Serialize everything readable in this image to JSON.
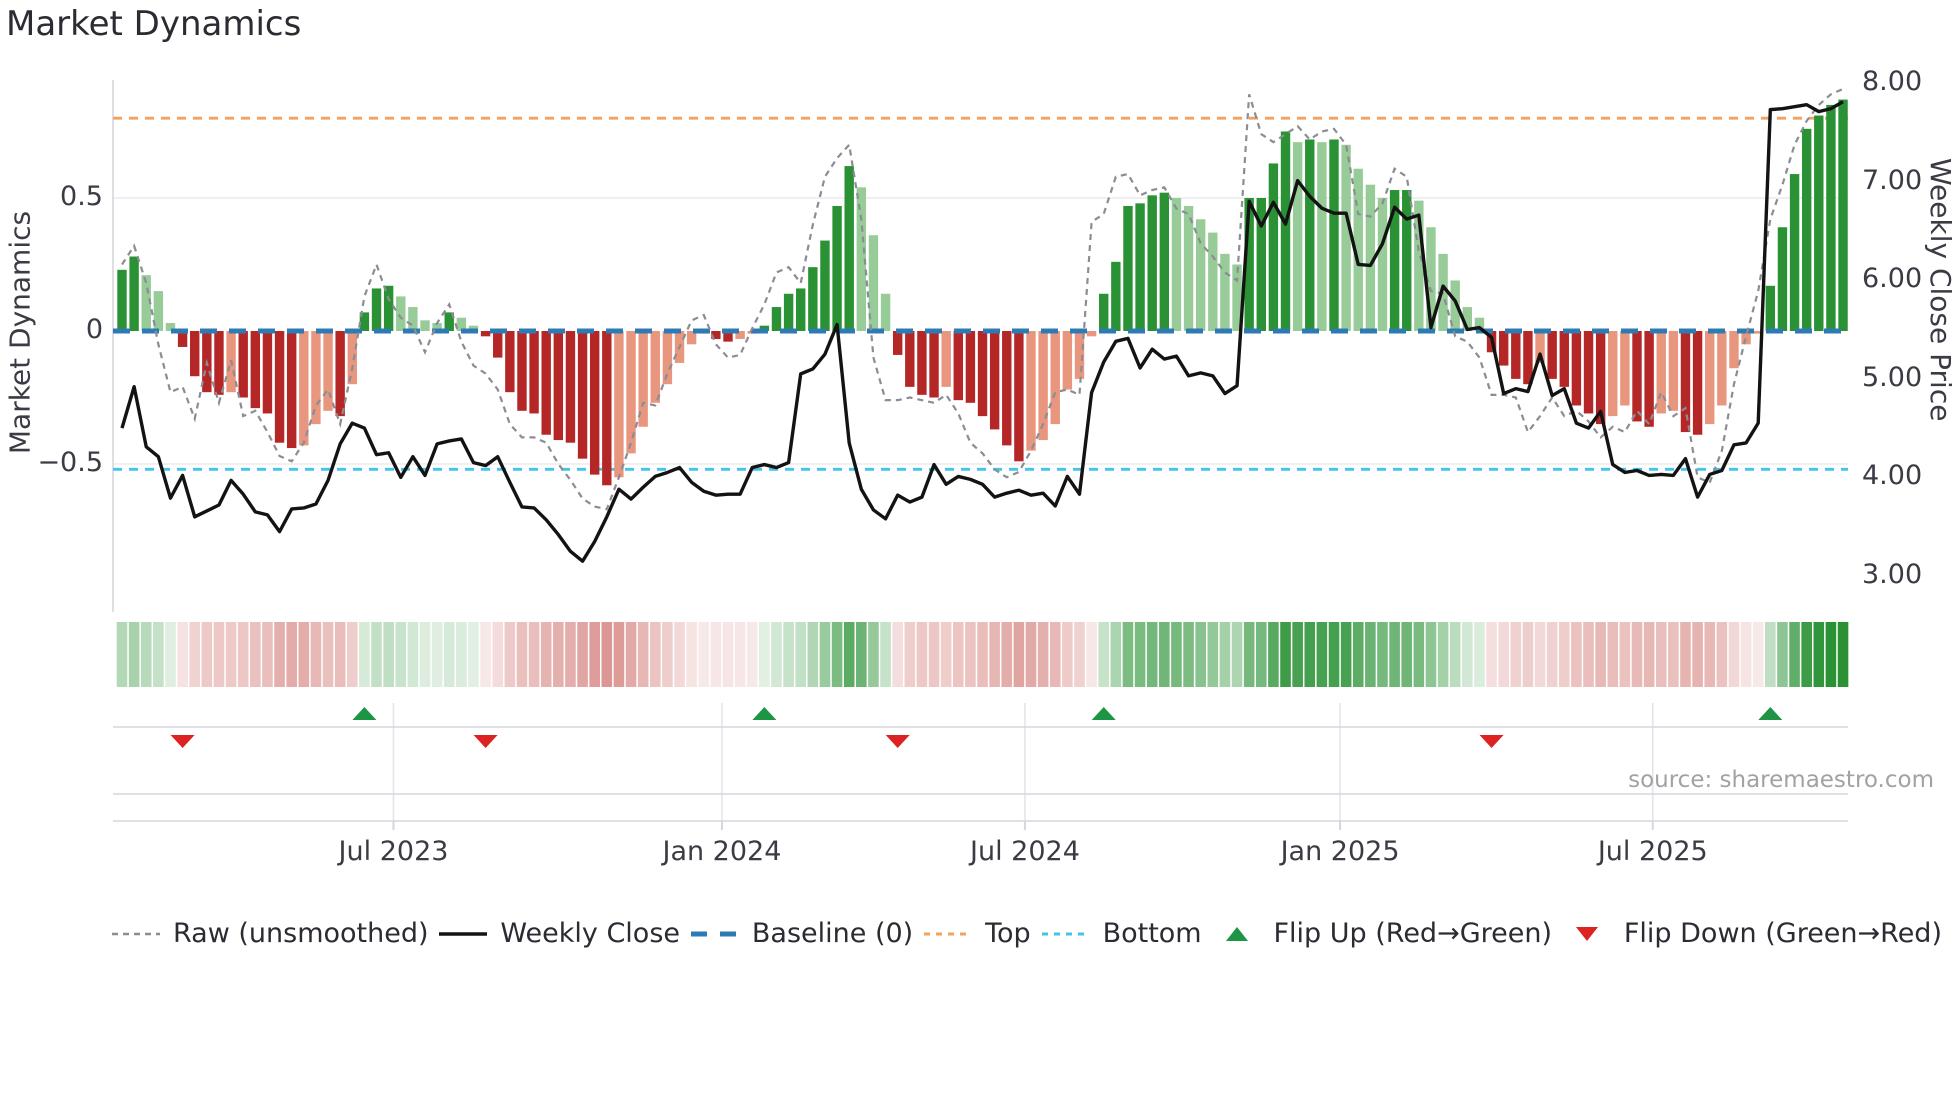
{
  "title": "Market Dynamics",
  "source": "source: sharemaestro.com",
  "axes": {
    "left_label": "Market Dynamics",
    "right_label": "Weekly Close Price",
    "left_ticks": [
      {
        "label": "0.5",
        "value": 0.5
      },
      {
        "label": "0",
        "value": 0.0
      },
      {
        "label": "−0.5",
        "value": -0.5
      }
    ],
    "right_ticks": [
      {
        "label": "8.00",
        "value": 8.0
      },
      {
        "label": "7.00",
        "value": 7.0
      },
      {
        "label": "6.00",
        "value": 6.0
      },
      {
        "label": "5.00",
        "value": 5.0
      },
      {
        "label": "4.00",
        "value": 4.0
      },
      {
        "label": "3.00",
        "value": 3.0
      }
    ],
    "x_ticks": [
      {
        "label": "Jul 2023",
        "week": 22.4
      },
      {
        "label": "Jan 2024",
        "week": 49.5
      },
      {
        "label": "Jul 2024",
        "week": 74.5
      },
      {
        "label": "Jan 2025",
        "week": 100.5
      },
      {
        "label": "Jul 2025",
        "week": 126.3
      }
    ]
  },
  "legend": [
    {
      "label": "Raw (unsmoothed)",
      "swatch": "dashed-gray-line"
    },
    {
      "label": "Weekly Close",
      "swatch": "solid-black-line"
    },
    {
      "label": "Baseline (0)",
      "swatch": "dashed-blue-line"
    },
    {
      "label": "Top",
      "swatch": "dotted-orange-line"
    },
    {
      "label": "Bottom",
      "swatch": "dotted-cyan-line"
    },
    {
      "label": "Flip Up (Red→Green)",
      "swatch": "triangle-up-green"
    },
    {
      "label": "Flip Down (Green→Red)",
      "swatch": "triangle-down-red"
    }
  ],
  "colors": {
    "bar_dark_green": "#2a9235",
    "bar_light_green": "#97cb98",
    "bar_dark_red": "#b52727",
    "bar_light_red": "#e9967f",
    "baseline_blue": "#2e7bb4",
    "top_orange": "#f0a25f",
    "bottom_cyan": "#3fc6ea",
    "raw_gray": "#8c8c94",
    "close_black": "#131313",
    "grid_gray": "#ebebf0",
    "spine_gray": "#d6d6de",
    "heat_green_base": [
      42,
      146,
      53
    ],
    "heat_red_base": [
      198,
      86,
      80
    ]
  },
  "chart_data": {
    "type": "bar",
    "title": "Market Dynamics",
    "x_unit": "week",
    "start_date": "2023-01-30",
    "weeks": 143,
    "left_axis": {
      "label": "Market Dynamics",
      "ylim": [
        -1.06,
        0.94
      ],
      "gridlines": [
        0.5,
        -0.5
      ]
    },
    "right_axis": {
      "label": "Weekly Close Price",
      "ylim": [
        2.63,
        8.03
      ]
    },
    "reference_lines": {
      "baseline": 0.0,
      "top": 0.8,
      "bottom": -0.52
    },
    "flip_up_weeks": [
      20,
      53,
      81,
      136
    ],
    "flip_down_weeks": [
      5,
      30,
      64,
      113
    ],
    "series": [
      {
        "name": "Oscillator histogram (smoothed)",
        "axis": "left",
        "type": "bar",
        "values": [
          0.23,
          0.28,
          0.21,
          0.15,
          0.03,
          -0.06,
          -0.17,
          -0.23,
          -0.24,
          -0.23,
          -0.25,
          -0.29,
          -0.31,
          -0.42,
          -0.44,
          -0.43,
          -0.35,
          -0.3,
          -0.32,
          -0.2,
          0.07,
          0.16,
          0.17,
          0.13,
          0.09,
          0.04,
          0.03,
          0.07,
          0.05,
          0.02,
          -0.02,
          -0.1,
          -0.23,
          -0.3,
          -0.31,
          -0.39,
          -0.41,
          -0.42,
          -0.48,
          -0.54,
          -0.58,
          -0.55,
          -0.46,
          -0.36,
          -0.27,
          -0.2,
          -0.12,
          -0.05,
          -0.01,
          -0.03,
          -0.04,
          -0.03,
          -0.01,
          0.02,
          0.09,
          0.14,
          0.16,
          0.24,
          0.34,
          0.47,
          0.62,
          0.54,
          0.36,
          0.14,
          -0.09,
          -0.21,
          -0.24,
          -0.25,
          -0.21,
          -0.26,
          -0.27,
          -0.32,
          -0.37,
          -0.43,
          -0.49,
          -0.45,
          -0.41,
          -0.35,
          -0.22,
          -0.18,
          -0.02,
          0.14,
          0.26,
          0.47,
          0.48,
          0.51,
          0.52,
          0.5,
          0.47,
          0.42,
          0.37,
          0.29,
          0.25,
          0.5,
          0.5,
          0.63,
          0.75,
          0.71,
          0.72,
          0.71,
          0.72,
          0.7,
          0.61,
          0.55,
          0.5,
          0.53,
          0.53,
          0.49,
          0.39,
          0.29,
          0.19,
          0.09,
          0.05,
          -0.08,
          -0.13,
          -0.18,
          -0.2,
          -0.12,
          -0.18,
          -0.21,
          -0.28,
          -0.31,
          -0.35,
          -0.32,
          -0.28,
          -0.34,
          -0.36,
          -0.31,
          -0.3,
          -0.38,
          -0.39,
          -0.35,
          -0.28,
          -0.14,
          -0.05,
          -0.01,
          0.17,
          0.39,
          0.59,
          0.76,
          0.81,
          0.85,
          0.87
        ]
      },
      {
        "name": "Raw (unsmoothed)",
        "axis": "left",
        "type": "line",
        "style": "dashed",
        "values": [
          0.25,
          0.32,
          0.18,
          -0.05,
          -0.23,
          -0.21,
          -0.33,
          -0.12,
          -0.27,
          -0.11,
          -0.32,
          -0.3,
          -0.38,
          -0.47,
          -0.49,
          -0.42,
          -0.28,
          -0.22,
          -0.35,
          -0.14,
          0.13,
          0.25,
          0.12,
          0.05,
          0.02,
          -0.08,
          0.03,
          0.1,
          -0.04,
          -0.13,
          -0.16,
          -0.22,
          -0.35,
          -0.4,
          -0.4,
          -0.42,
          -0.5,
          -0.56,
          -0.63,
          -0.66,
          -0.67,
          -0.55,
          -0.42,
          -0.27,
          -0.28,
          -0.16,
          -0.06,
          0.04,
          0.06,
          -0.05,
          -0.1,
          -0.09,
          0.01,
          0.1,
          0.22,
          0.24,
          0.18,
          0.4,
          0.58,
          0.65,
          0.7,
          0.42,
          -0.1,
          -0.26,
          -0.26,
          -0.25,
          -0.26,
          -0.27,
          -0.24,
          -0.31,
          -0.42,
          -0.46,
          -0.52,
          -0.55,
          -0.53,
          -0.45,
          -0.35,
          -0.23,
          -0.22,
          -0.24,
          0.41,
          0.44,
          0.58,
          0.59,
          0.51,
          0.53,
          0.54,
          0.46,
          0.44,
          0.33,
          0.28,
          0.22,
          0.19,
          0.89,
          0.74,
          0.71,
          0.74,
          0.77,
          0.72,
          0.75,
          0.76,
          0.7,
          0.44,
          0.43,
          0.48,
          0.61,
          0.58,
          0.3,
          0.15,
          0.14,
          -0.02,
          -0.04,
          -0.1,
          -0.24,
          -0.24,
          -0.25,
          -0.38,
          -0.32,
          -0.25,
          -0.32,
          -0.3,
          -0.34,
          -0.4,
          -0.36,
          -0.38,
          -0.3,
          -0.35,
          -0.23,
          -0.32,
          -0.29,
          -0.55,
          -0.57,
          -0.45,
          -0.2,
          -0.02,
          0.15,
          0.42,
          0.55,
          0.7,
          0.79,
          0.85,
          0.89,
          0.91
        ]
      },
      {
        "name": "Weekly Close",
        "axis": "right",
        "type": "line",
        "style": "solid",
        "values": [
          4.5,
          4.92,
          4.31,
          4.21,
          3.79,
          4.02,
          3.6,
          3.66,
          3.72,
          3.97,
          3.83,
          3.65,
          3.62,
          3.45,
          3.68,
          3.69,
          3.73,
          3.97,
          4.34,
          4.55,
          4.5,
          4.23,
          4.25,
          4.0,
          4.21,
          4.02,
          4.34,
          4.37,
          4.39,
          4.15,
          4.12,
          4.21,
          3.95,
          3.7,
          3.69,
          3.57,
          3.42,
          3.25,
          3.15,
          3.35,
          3.6,
          3.88,
          3.78,
          3.9,
          4.01,
          4.05,
          4.1,
          3.95,
          3.86,
          3.82,
          3.83,
          3.83,
          4.1,
          4.13,
          4.1,
          4.15,
          5.05,
          5.1,
          5.25,
          5.55,
          4.35,
          3.88,
          3.67,
          3.58,
          3.82,
          3.75,
          3.8,
          4.13,
          3.93,
          4.01,
          3.98,
          3.93,
          3.8,
          3.84,
          3.87,
          3.82,
          3.84,
          3.71,
          4.01,
          3.83,
          4.86,
          5.17,
          5.38,
          5.41,
          5.11,
          5.3,
          5.2,
          5.23,
          5.03,
          5.06,
          5.03,
          4.85,
          4.93,
          6.8,
          6.55,
          6.79,
          6.57,
          7.01,
          6.85,
          6.73,
          6.68,
          6.68,
          6.16,
          6.15,
          6.37,
          6.74,
          6.62,
          6.66,
          5.52,
          5.94,
          5.79,
          5.5,
          5.52,
          5.42,
          4.85,
          4.9,
          4.87,
          5.25,
          4.83,
          4.9,
          4.55,
          4.5,
          4.67,
          4.13,
          4.05,
          4.07,
          4.02,
          4.03,
          4.02,
          4.19,
          3.8,
          4.03,
          4.07,
          4.33,
          4.35,
          4.55,
          7.73,
          7.74,
          7.76,
          7.78,
          7.71,
          7.74,
          7.81
        ]
      }
    ],
    "heatmap": {
      "note": "strip below main chart; per-week color = sign and magnitude of oscillator histogram"
    }
  }
}
